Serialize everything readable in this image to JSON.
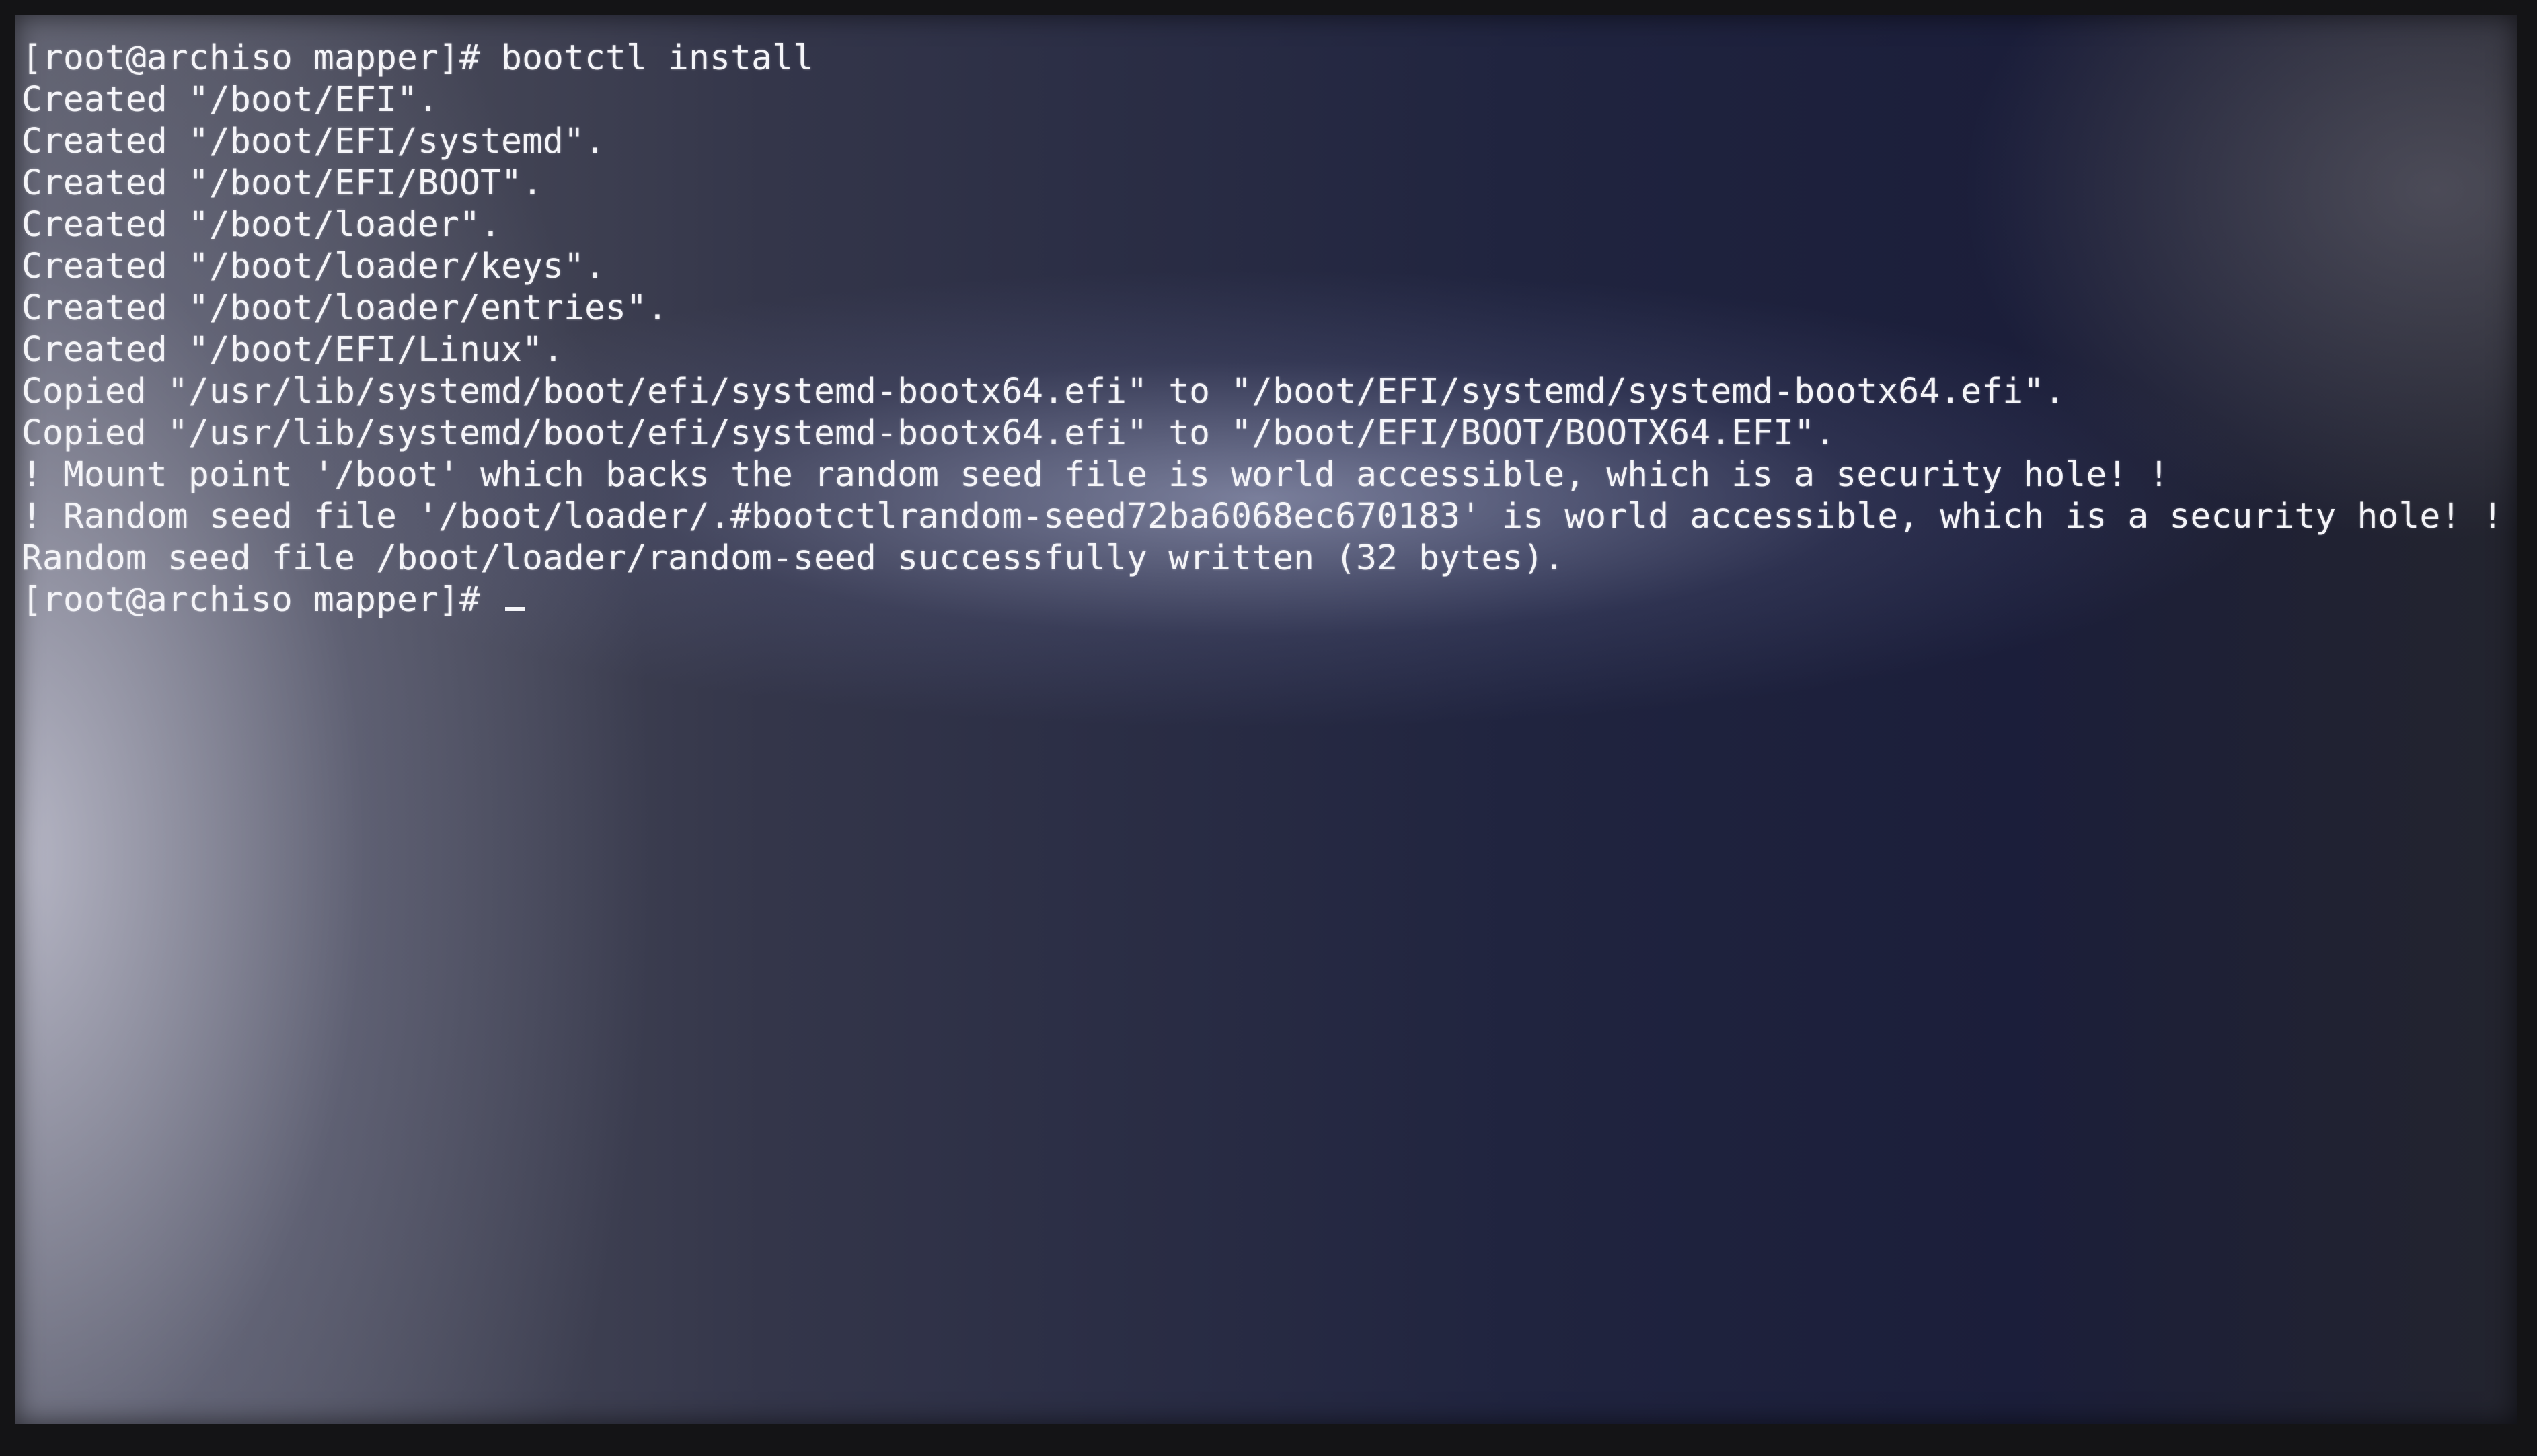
{
  "terminal": {
    "lines": [
      "[root@archiso mapper]# bootctl install",
      "Created \"/boot/EFI\".",
      "Created \"/boot/EFI/systemd\".",
      "Created \"/boot/EFI/BOOT\".",
      "Created \"/boot/loader\".",
      "Created \"/boot/loader/keys\".",
      "Created \"/boot/loader/entries\".",
      "Created \"/boot/EFI/Linux\".",
      "Copied \"/usr/lib/systemd/boot/efi/systemd-bootx64.efi\" to \"/boot/EFI/systemd/systemd-bootx64.efi\".",
      "Copied \"/usr/lib/systemd/boot/efi/systemd-bootx64.efi\" to \"/boot/EFI/BOOT/BOOTX64.EFI\".",
      "! Mount point '/boot' which backs the random seed file is world accessible, which is a security hole! !",
      "! Random seed file '/boot/loader/.#bootctlrandom-seed72ba6068ec670183' is world accessible, which is a security hole! !",
      "Random seed file /boot/loader/random-seed successfully written (32 bytes)."
    ],
    "prompt": "[root@archiso mapper]# "
  }
}
